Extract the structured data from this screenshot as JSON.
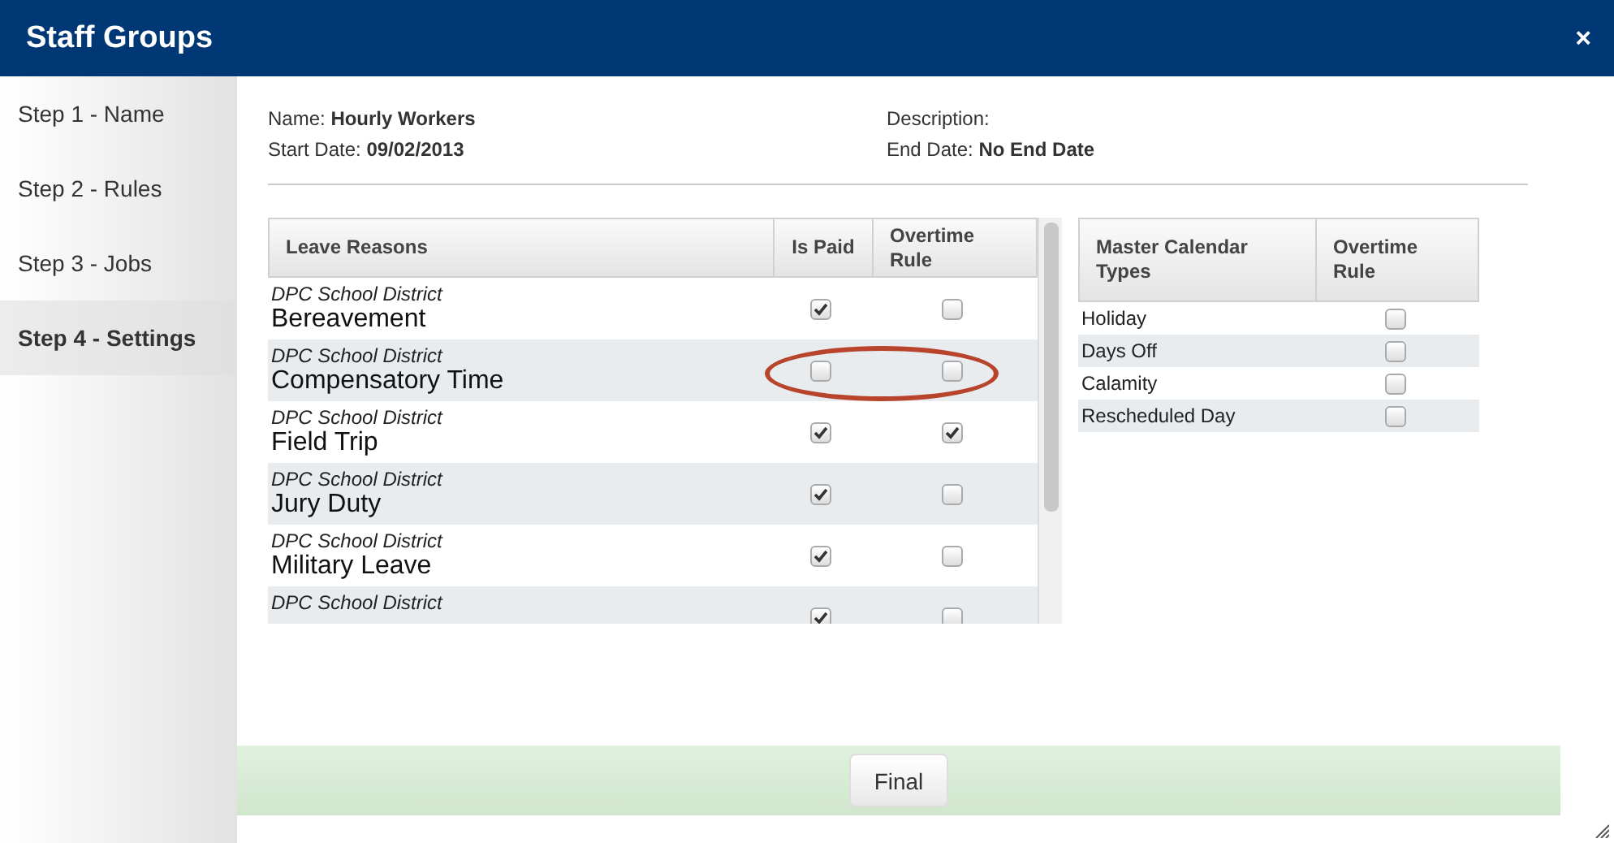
{
  "window": {
    "title": "Staff Groups",
    "close": "×"
  },
  "steps": [
    {
      "label": "Step 1 - Name",
      "selected": false
    },
    {
      "label": "Step 2 - Rules",
      "selected": false
    },
    {
      "label": "Step 3 - Jobs",
      "selected": false
    },
    {
      "label": "Step 4 - Settings",
      "selected": true
    }
  ],
  "info": {
    "name_label": "Name:",
    "name": "Hourly Workers",
    "start_label": "Start Date:",
    "start": "09/02/2013",
    "description_label": "Description:",
    "end_label": "End Date:",
    "end": "No End Date"
  },
  "leave_table": {
    "columns": [
      "Leave Reasons",
      "Is Paid",
      "Overtime Rule"
    ],
    "rows": [
      {
        "district": "DPC School District",
        "name": "Bereavement",
        "is_paid": true,
        "overtime": false,
        "circled": false
      },
      {
        "district": "DPC School District",
        "name": "Compensatory Time",
        "is_paid": false,
        "overtime": false,
        "circled": true
      },
      {
        "district": "DPC School District",
        "name": "Field Trip",
        "is_paid": true,
        "overtime": true,
        "circled": false
      },
      {
        "district": "DPC School District",
        "name": "Jury Duty",
        "is_paid": true,
        "overtime": false,
        "circled": false
      },
      {
        "district": "DPC School District",
        "name": "Military Leave",
        "is_paid": true,
        "overtime": false,
        "circled": false
      },
      {
        "district": "DPC School District",
        "is_paid": true,
        "overtime": false,
        "circled": false
      }
    ]
  },
  "calendar_table": {
    "columns": [
      "Master Calendar Types",
      "Overtime Rule"
    ],
    "rows": [
      {
        "name": "Holiday",
        "overtime": false
      },
      {
        "name": "Days Off",
        "overtime": false
      },
      {
        "name": "Calamity",
        "overtime": false
      },
      {
        "name": "Rescheduled Day",
        "overtime": false
      }
    ]
  },
  "footer": {
    "button": "Final"
  }
}
